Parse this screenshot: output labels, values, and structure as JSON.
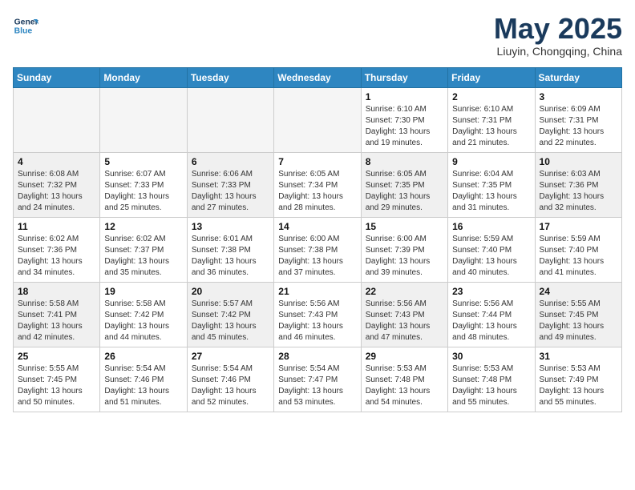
{
  "header": {
    "logo_line1": "General",
    "logo_line2": "Blue",
    "month": "May 2025",
    "location": "Liuyin, Chongqing, China"
  },
  "weekdays": [
    "Sunday",
    "Monday",
    "Tuesday",
    "Wednesday",
    "Thursday",
    "Friday",
    "Saturday"
  ],
  "weeks": [
    [
      {
        "day": "",
        "info": ""
      },
      {
        "day": "",
        "info": ""
      },
      {
        "day": "",
        "info": ""
      },
      {
        "day": "",
        "info": ""
      },
      {
        "day": "1",
        "info": "Sunrise: 6:10 AM\nSunset: 7:30 PM\nDaylight: 13 hours\nand 19 minutes."
      },
      {
        "day": "2",
        "info": "Sunrise: 6:10 AM\nSunset: 7:31 PM\nDaylight: 13 hours\nand 21 minutes."
      },
      {
        "day": "3",
        "info": "Sunrise: 6:09 AM\nSunset: 7:31 PM\nDaylight: 13 hours\nand 22 minutes."
      }
    ],
    [
      {
        "day": "4",
        "info": "Sunrise: 6:08 AM\nSunset: 7:32 PM\nDaylight: 13 hours\nand 24 minutes."
      },
      {
        "day": "5",
        "info": "Sunrise: 6:07 AM\nSunset: 7:33 PM\nDaylight: 13 hours\nand 25 minutes."
      },
      {
        "day": "6",
        "info": "Sunrise: 6:06 AM\nSunset: 7:33 PM\nDaylight: 13 hours\nand 27 minutes."
      },
      {
        "day": "7",
        "info": "Sunrise: 6:05 AM\nSunset: 7:34 PM\nDaylight: 13 hours\nand 28 minutes."
      },
      {
        "day": "8",
        "info": "Sunrise: 6:05 AM\nSunset: 7:35 PM\nDaylight: 13 hours\nand 29 minutes."
      },
      {
        "day": "9",
        "info": "Sunrise: 6:04 AM\nSunset: 7:35 PM\nDaylight: 13 hours\nand 31 minutes."
      },
      {
        "day": "10",
        "info": "Sunrise: 6:03 AM\nSunset: 7:36 PM\nDaylight: 13 hours\nand 32 minutes."
      }
    ],
    [
      {
        "day": "11",
        "info": "Sunrise: 6:02 AM\nSunset: 7:36 PM\nDaylight: 13 hours\nand 34 minutes."
      },
      {
        "day": "12",
        "info": "Sunrise: 6:02 AM\nSunset: 7:37 PM\nDaylight: 13 hours\nand 35 minutes."
      },
      {
        "day": "13",
        "info": "Sunrise: 6:01 AM\nSunset: 7:38 PM\nDaylight: 13 hours\nand 36 minutes."
      },
      {
        "day": "14",
        "info": "Sunrise: 6:00 AM\nSunset: 7:38 PM\nDaylight: 13 hours\nand 37 minutes."
      },
      {
        "day": "15",
        "info": "Sunrise: 6:00 AM\nSunset: 7:39 PM\nDaylight: 13 hours\nand 39 minutes."
      },
      {
        "day": "16",
        "info": "Sunrise: 5:59 AM\nSunset: 7:40 PM\nDaylight: 13 hours\nand 40 minutes."
      },
      {
        "day": "17",
        "info": "Sunrise: 5:59 AM\nSunset: 7:40 PM\nDaylight: 13 hours\nand 41 minutes."
      }
    ],
    [
      {
        "day": "18",
        "info": "Sunrise: 5:58 AM\nSunset: 7:41 PM\nDaylight: 13 hours\nand 42 minutes."
      },
      {
        "day": "19",
        "info": "Sunrise: 5:58 AM\nSunset: 7:42 PM\nDaylight: 13 hours\nand 44 minutes."
      },
      {
        "day": "20",
        "info": "Sunrise: 5:57 AM\nSunset: 7:42 PM\nDaylight: 13 hours\nand 45 minutes."
      },
      {
        "day": "21",
        "info": "Sunrise: 5:56 AM\nSunset: 7:43 PM\nDaylight: 13 hours\nand 46 minutes."
      },
      {
        "day": "22",
        "info": "Sunrise: 5:56 AM\nSunset: 7:43 PM\nDaylight: 13 hours\nand 47 minutes."
      },
      {
        "day": "23",
        "info": "Sunrise: 5:56 AM\nSunset: 7:44 PM\nDaylight: 13 hours\nand 48 minutes."
      },
      {
        "day": "24",
        "info": "Sunrise: 5:55 AM\nSunset: 7:45 PM\nDaylight: 13 hours\nand 49 minutes."
      }
    ],
    [
      {
        "day": "25",
        "info": "Sunrise: 5:55 AM\nSunset: 7:45 PM\nDaylight: 13 hours\nand 50 minutes."
      },
      {
        "day": "26",
        "info": "Sunrise: 5:54 AM\nSunset: 7:46 PM\nDaylight: 13 hours\nand 51 minutes."
      },
      {
        "day": "27",
        "info": "Sunrise: 5:54 AM\nSunset: 7:46 PM\nDaylight: 13 hours\nand 52 minutes."
      },
      {
        "day": "28",
        "info": "Sunrise: 5:54 AM\nSunset: 7:47 PM\nDaylight: 13 hours\nand 53 minutes."
      },
      {
        "day": "29",
        "info": "Sunrise: 5:53 AM\nSunset: 7:48 PM\nDaylight: 13 hours\nand 54 minutes."
      },
      {
        "day": "30",
        "info": "Sunrise: 5:53 AM\nSunset: 7:48 PM\nDaylight: 13 hours\nand 55 minutes."
      },
      {
        "day": "31",
        "info": "Sunrise: 5:53 AM\nSunset: 7:49 PM\nDaylight: 13 hours\nand 55 minutes."
      }
    ]
  ]
}
